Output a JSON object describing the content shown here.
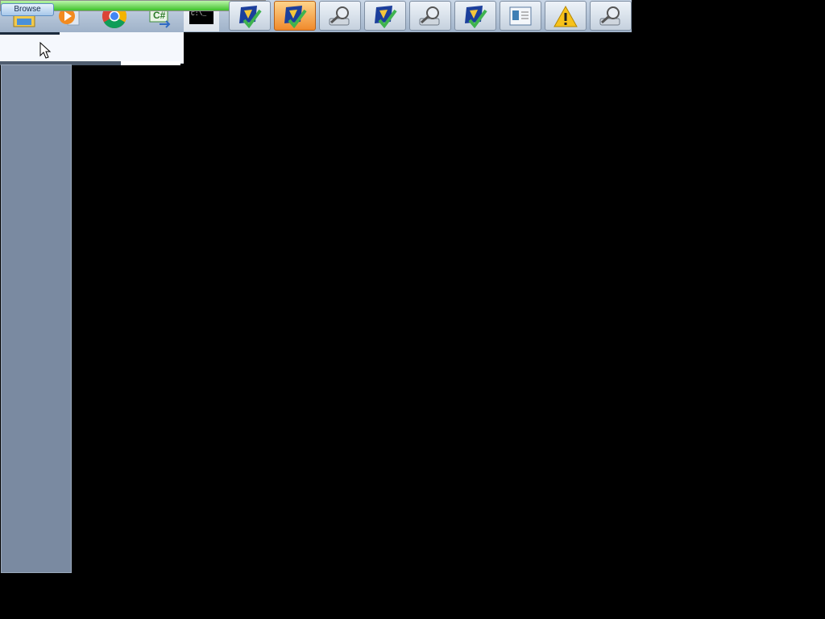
{
  "taskbar": {
    "browse_label": "Browse",
    "progress_fraction": 0.9,
    "pinned": [
      {
        "name": "file-explorer-icon"
      },
      {
        "name": "media-player-icon"
      },
      {
        "name": "chrome-icon"
      },
      {
        "name": "csharp-project-icon"
      },
      {
        "name": "terminal-icon"
      }
    ],
    "windows": [
      {
        "name": "shield-check-icon",
        "active": false
      },
      {
        "name": "shield-warning-icon",
        "active": true
      },
      {
        "name": "magnifier-drive-icon",
        "active": false
      },
      {
        "name": "shield-check-icon",
        "active": false
      },
      {
        "name": "magnifier-drive-icon",
        "active": false
      },
      {
        "name": "shield-check-icon",
        "active": false
      },
      {
        "name": "window-app-icon",
        "active": false
      },
      {
        "name": "warning-icon",
        "active": false
      },
      {
        "name": "magnifier-drive-icon",
        "active": false
      }
    ]
  },
  "colors": {
    "desktop_background": "#000000",
    "sidebar": "#7a8aa1",
    "active_button": "#f08a2c",
    "progress_green": "#3fc12b"
  }
}
